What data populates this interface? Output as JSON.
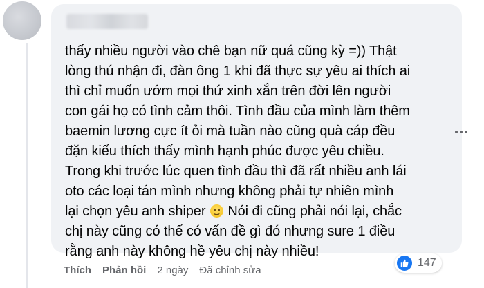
{
  "comment": {
    "lines": [
      "thấy nhiều người vào chê bạn nữ quá cũng kỳ =)) Thật",
      "lòng thú nhận đi, đàn ông 1 khi đã thực sự yêu ai thích ai",
      "thì chỉ muốn ướm mọi thứ xinh xắn trên đời lên người",
      "con gái họ có tình cảm thôi. Tình đầu của mình làm thêm",
      "baemin lương cực ít ỏi mà tuần nào cũng quà cáp đều",
      "đặn kiểu thích thấy mình hạnh phúc được yêu chiều.",
      "Trong khi trước lúc quen tình đầu thì đã rất nhiều anh lái",
      "oto các loại tán mình nhưng không phải tự nhiên mình"
    ],
    "line9_before_emoji": "lại chọn yêu anh shiper ",
    "line9_after_emoji": " Nói đi cũng phải nói lại, chắc",
    "lines_tail": [
      "chị này cũng có thể có vấn đề gì đó nhưng sure 1 điều",
      "rằng anh này không hề yêu chị này nhiều!"
    ],
    "emoji_icon": "smiling-face-emoji"
  },
  "actions": {
    "like_label": "Thích",
    "reply_label": "Phản hồi",
    "time": "2 ngày",
    "edited": "Đã chỉnh sửa"
  },
  "reactions": {
    "icon": "thumbs-up-icon",
    "count": "147",
    "color": "#1877f2"
  },
  "colors": {
    "bubble": "#f0f2f5",
    "text": "#050505",
    "secondary": "#65676b"
  }
}
